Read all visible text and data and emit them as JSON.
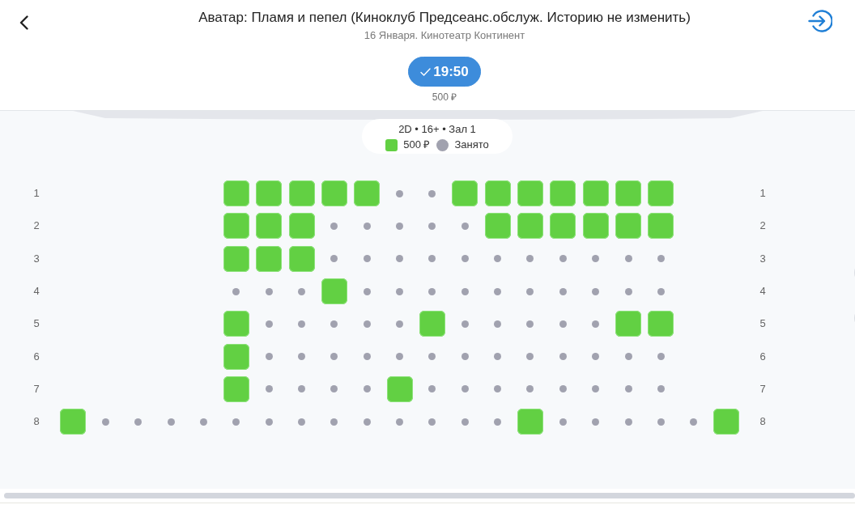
{
  "header": {
    "title": "Аватар: Пламя и пепел (Киноклуб Предсеанс.обслуж. Историю не изменить)",
    "subtitle": "16 Января. Кинотеатр Континент"
  },
  "showtimes": [
    {
      "time": "19:50",
      "price": "500 ₽",
      "selected": true
    }
  ],
  "hall": {
    "info": "2D • 16+ • Зал 1",
    "legend": [
      {
        "kind": "free",
        "label": "500 ₽"
      },
      {
        "kind": "taken",
        "label": "Занято"
      }
    ]
  },
  "rows": [
    {
      "label": "1",
      "label_end": "1",
      "seats": [
        {
          "kind": "gap"
        },
        {
          "kind": "gap"
        },
        {
          "kind": "gap"
        },
        {
          "kind": "gap"
        },
        {
          "kind": "gap"
        },
        {
          "kind": "seat",
          "taken": false
        },
        {
          "kind": "seat",
          "taken": false
        },
        {
          "kind": "seat",
          "taken": false
        },
        {
          "kind": "seat",
          "taken": false
        },
        {
          "kind": "seat",
          "taken": false
        },
        {
          "kind": "seat",
          "taken": true
        },
        {
          "kind": "seat",
          "taken": true
        },
        {
          "kind": "seat",
          "taken": false
        },
        {
          "kind": "seat",
          "taken": false
        },
        {
          "kind": "seat",
          "taken": false
        },
        {
          "kind": "seat",
          "taken": false
        },
        {
          "kind": "seat",
          "taken": false
        },
        {
          "kind": "seat",
          "taken": false
        },
        {
          "kind": "seat",
          "taken": false
        },
        {
          "kind": "gap"
        },
        {
          "kind": "gap"
        }
      ]
    },
    {
      "label": "2",
      "label_end": "2",
      "seats": [
        {
          "kind": "gap"
        },
        {
          "kind": "gap"
        },
        {
          "kind": "gap"
        },
        {
          "kind": "gap"
        },
        {
          "kind": "gap"
        },
        {
          "kind": "seat",
          "taken": false
        },
        {
          "kind": "seat",
          "taken": false
        },
        {
          "kind": "seat",
          "taken": false
        },
        {
          "kind": "seat",
          "taken": true
        },
        {
          "kind": "seat",
          "taken": true
        },
        {
          "kind": "seat",
          "taken": true
        },
        {
          "kind": "seat",
          "taken": true
        },
        {
          "kind": "seat",
          "taken": true
        },
        {
          "kind": "seat",
          "taken": false
        },
        {
          "kind": "seat",
          "taken": false
        },
        {
          "kind": "seat",
          "taken": false
        },
        {
          "kind": "seat",
          "taken": false
        },
        {
          "kind": "seat",
          "taken": false
        },
        {
          "kind": "seat",
          "taken": false
        },
        {
          "kind": "gap"
        },
        {
          "kind": "gap"
        }
      ]
    },
    {
      "label": "3",
      "label_end": "3",
      "seats": [
        {
          "kind": "gap"
        },
        {
          "kind": "gap"
        },
        {
          "kind": "gap"
        },
        {
          "kind": "gap"
        },
        {
          "kind": "gap"
        },
        {
          "kind": "seat",
          "taken": false
        },
        {
          "kind": "seat",
          "taken": false
        },
        {
          "kind": "seat",
          "taken": false
        },
        {
          "kind": "seat",
          "taken": true
        },
        {
          "kind": "seat",
          "taken": true
        },
        {
          "kind": "seat",
          "taken": true
        },
        {
          "kind": "seat",
          "taken": true
        },
        {
          "kind": "seat",
          "taken": true
        },
        {
          "kind": "seat",
          "taken": true
        },
        {
          "kind": "seat",
          "taken": true
        },
        {
          "kind": "seat",
          "taken": true
        },
        {
          "kind": "seat",
          "taken": true
        },
        {
          "kind": "seat",
          "taken": true
        },
        {
          "kind": "seat",
          "taken": true
        },
        {
          "kind": "gap"
        },
        {
          "kind": "gap"
        }
      ]
    },
    {
      "label": "4",
      "label_end": "4",
      "seats": [
        {
          "kind": "gap"
        },
        {
          "kind": "gap"
        },
        {
          "kind": "gap"
        },
        {
          "kind": "gap"
        },
        {
          "kind": "gap"
        },
        {
          "kind": "seat",
          "taken": true
        },
        {
          "kind": "seat",
          "taken": true
        },
        {
          "kind": "seat",
          "taken": true
        },
        {
          "kind": "seat",
          "taken": false
        },
        {
          "kind": "seat",
          "taken": true
        },
        {
          "kind": "seat",
          "taken": true
        },
        {
          "kind": "seat",
          "taken": true
        },
        {
          "kind": "seat",
          "taken": true
        },
        {
          "kind": "seat",
          "taken": true
        },
        {
          "kind": "seat",
          "taken": true
        },
        {
          "kind": "seat",
          "taken": true
        },
        {
          "kind": "seat",
          "taken": true
        },
        {
          "kind": "seat",
          "taken": true
        },
        {
          "kind": "seat",
          "taken": true
        },
        {
          "kind": "gap"
        },
        {
          "kind": "gap"
        }
      ]
    },
    {
      "label": "5",
      "label_end": "5",
      "seats": [
        {
          "kind": "gap"
        },
        {
          "kind": "gap"
        },
        {
          "kind": "gap"
        },
        {
          "kind": "gap"
        },
        {
          "kind": "gap"
        },
        {
          "kind": "seat",
          "taken": false
        },
        {
          "kind": "seat",
          "taken": true
        },
        {
          "kind": "seat",
          "taken": true
        },
        {
          "kind": "seat",
          "taken": true
        },
        {
          "kind": "seat",
          "taken": true
        },
        {
          "kind": "seat",
          "taken": true
        },
        {
          "kind": "seat",
          "taken": false
        },
        {
          "kind": "seat",
          "taken": true
        },
        {
          "kind": "seat",
          "taken": true
        },
        {
          "kind": "seat",
          "taken": true
        },
        {
          "kind": "seat",
          "taken": true
        },
        {
          "kind": "seat",
          "taken": true
        },
        {
          "kind": "seat",
          "taken": false
        },
        {
          "kind": "seat",
          "taken": false
        },
        {
          "kind": "gap"
        },
        {
          "kind": "gap"
        }
      ]
    },
    {
      "label": "6",
      "label_end": "6",
      "seats": [
        {
          "kind": "gap"
        },
        {
          "kind": "gap"
        },
        {
          "kind": "gap"
        },
        {
          "kind": "gap"
        },
        {
          "kind": "gap"
        },
        {
          "kind": "seat",
          "taken": false
        },
        {
          "kind": "seat",
          "taken": true
        },
        {
          "kind": "seat",
          "taken": true
        },
        {
          "kind": "seat",
          "taken": true
        },
        {
          "kind": "seat",
          "taken": true
        },
        {
          "kind": "seat",
          "taken": true
        },
        {
          "kind": "seat",
          "taken": true
        },
        {
          "kind": "seat",
          "taken": true
        },
        {
          "kind": "seat",
          "taken": true
        },
        {
          "kind": "seat",
          "taken": true
        },
        {
          "kind": "seat",
          "taken": true
        },
        {
          "kind": "seat",
          "taken": true
        },
        {
          "kind": "seat",
          "taken": true
        },
        {
          "kind": "seat",
          "taken": true
        },
        {
          "kind": "gap"
        },
        {
          "kind": "gap"
        }
      ]
    },
    {
      "label": "7",
      "label_end": "7",
      "seats": [
        {
          "kind": "gap"
        },
        {
          "kind": "gap"
        },
        {
          "kind": "gap"
        },
        {
          "kind": "gap"
        },
        {
          "kind": "gap"
        },
        {
          "kind": "seat",
          "taken": false
        },
        {
          "kind": "seat",
          "taken": true
        },
        {
          "kind": "seat",
          "taken": true
        },
        {
          "kind": "seat",
          "taken": true
        },
        {
          "kind": "seat",
          "taken": true
        },
        {
          "kind": "seat",
          "taken": false
        },
        {
          "kind": "seat",
          "taken": true
        },
        {
          "kind": "seat",
          "taken": true
        },
        {
          "kind": "seat",
          "taken": true
        },
        {
          "kind": "seat",
          "taken": true
        },
        {
          "kind": "seat",
          "taken": true
        },
        {
          "kind": "seat",
          "taken": true
        },
        {
          "kind": "seat",
          "taken": true
        },
        {
          "kind": "seat",
          "taken": true
        },
        {
          "kind": "gap"
        },
        {
          "kind": "gap"
        }
      ]
    },
    {
      "label": "8",
      "label_end": "8",
      "seats": [
        {
          "kind": "seat",
          "taken": false
        },
        {
          "kind": "seat",
          "taken": true
        },
        {
          "kind": "seat",
          "taken": true
        },
        {
          "kind": "seat",
          "taken": true
        },
        {
          "kind": "seat",
          "taken": true
        },
        {
          "kind": "seat",
          "taken": true
        },
        {
          "kind": "seat",
          "taken": true
        },
        {
          "kind": "seat",
          "taken": true
        },
        {
          "kind": "seat",
          "taken": true
        },
        {
          "kind": "seat",
          "taken": true
        },
        {
          "kind": "seat",
          "taken": true
        },
        {
          "kind": "seat",
          "taken": true
        },
        {
          "kind": "seat",
          "taken": true
        },
        {
          "kind": "seat",
          "taken": true
        },
        {
          "kind": "seat",
          "taken": false
        },
        {
          "kind": "seat",
          "taken": true
        },
        {
          "kind": "seat",
          "taken": true
        },
        {
          "kind": "seat",
          "taken": true
        },
        {
          "kind": "seat",
          "taken": true
        },
        {
          "kind": "seat",
          "taken": true
        },
        {
          "kind": "seat",
          "taken": false
        }
      ]
    }
  ]
}
